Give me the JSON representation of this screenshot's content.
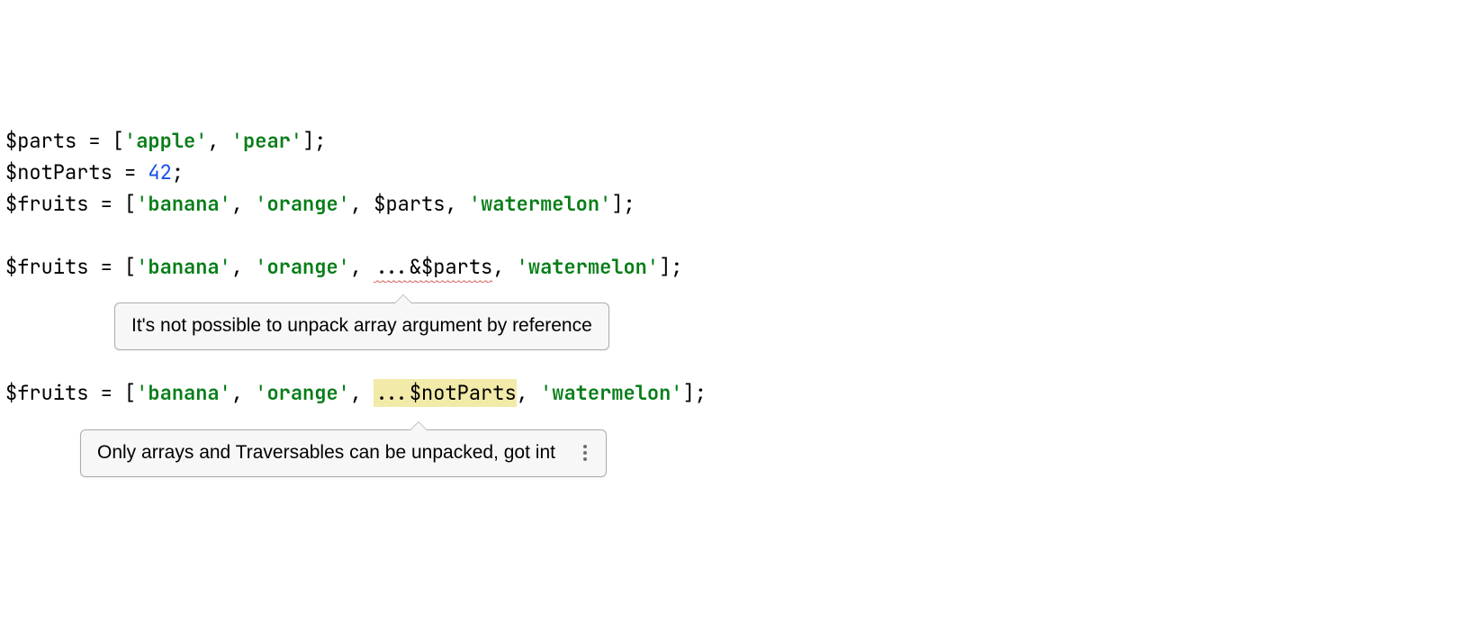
{
  "code": {
    "line1": {
      "var": "$parts",
      "eq": " = [",
      "s1": "apple",
      "c1": ", ",
      "s2": "pear",
      "end": "];"
    },
    "line2": {
      "var": "$notParts",
      "eq": " = ",
      "num": "42",
      "end": ";"
    },
    "line3": {
      "var": "$fruits",
      "eq": " = [",
      "s1": "banana",
      "c1": ", ",
      "s2": "orange",
      "c2": ", ",
      "spread_var": "$parts",
      "c3": ", ",
      "s3": "watermelon",
      "end": "];"
    },
    "line5": {
      "var": "$fruits",
      "eq": " = [",
      "s1": "banana",
      "c1": ", ",
      "s2": "orange",
      "c2": ", ",
      "spread": "...",
      "err": "&$parts",
      "c3": ", ",
      "s3": "watermelon",
      "end": "];"
    },
    "line7": {
      "var": "$fruits",
      "eq": " = [",
      "s1": "banana",
      "c1": ", ",
      "s2": "orange",
      "c2": ", ",
      "spread": "...",
      "warn_var": "$notParts",
      "c3": ", ",
      "s3": "watermelon",
      "end": "];"
    }
  },
  "tooltip1": {
    "text": "It's not possible to unpack array argument by reference"
  },
  "tooltip2": {
    "text": "Only arrays and Traversables can be unpacked, got int"
  }
}
